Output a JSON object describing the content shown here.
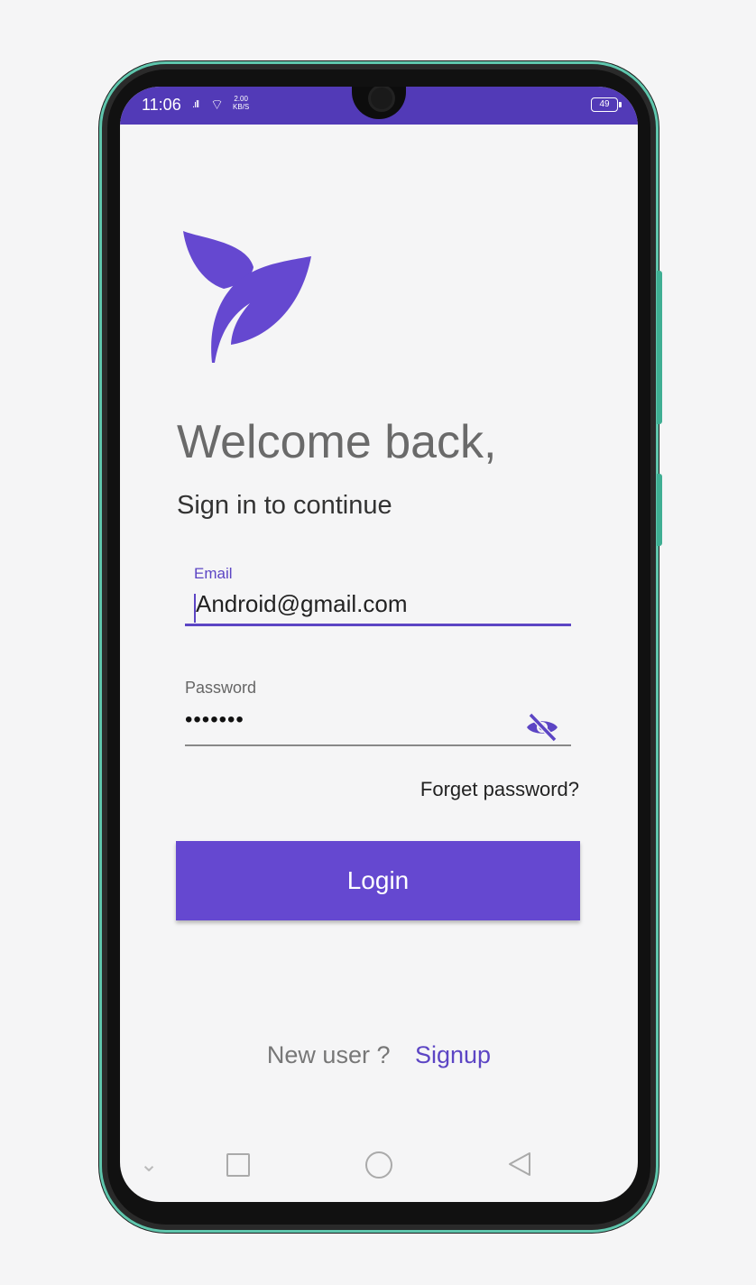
{
  "status_bar": {
    "time": "11:06",
    "signal": ".ıll",
    "wifi": "⌔",
    "net_speed_value": "2.00",
    "net_speed_unit": "KB/S",
    "battery": "49"
  },
  "login": {
    "welcome": "Welcome back,",
    "subtitle": "Sign in to continue",
    "email_label": "Email",
    "email_value": "Android@gmail.com",
    "password_label": "Password",
    "password_value": "•••••••",
    "forget_password": "Forget password?",
    "login_button": "Login",
    "new_user": "New user ?",
    "signup": "Signup"
  },
  "nav_bar": {
    "down": "⌄"
  },
  "colors": {
    "status_bar": "#523ab7",
    "accent": "#6548d0",
    "phone_frame_border": "#5fc6ad"
  }
}
